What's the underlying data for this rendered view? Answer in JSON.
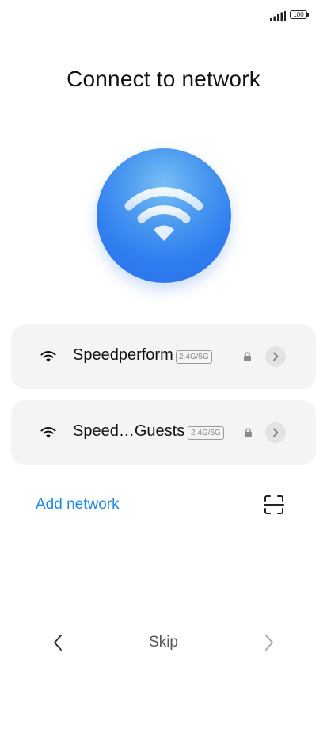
{
  "status_bar": {
    "battery_level": "100",
    "signal_icon": "cell-signal-icon",
    "battery_icon": "battery-icon"
  },
  "title": "Connect to network",
  "hero": {
    "icon": "wifi-icon",
    "gradient_colors": [
      "#79bff5",
      "#2f7df0"
    ]
  },
  "networks": [
    {
      "name": "Speedperform",
      "band": "2.4G/5G",
      "secured": true,
      "signal_icon": "wifi-icon",
      "detail_icon": "chevron-right-icon"
    },
    {
      "name": "Speed…Guests",
      "band": "2.4G/5G",
      "secured": true,
      "signal_icon": "wifi-icon",
      "detail_icon": "chevron-right-icon"
    }
  ],
  "add_network": {
    "label": "Add network",
    "scan_icon": "scan-qr-icon"
  },
  "nav": {
    "back_icon": "chevron-left-icon",
    "skip_label": "Skip",
    "next_icon": "chevron-right-icon"
  },
  "colors": {
    "accent": "#1a8ae6",
    "card_background": "#f4f4f4",
    "orb": "#2f7df0"
  }
}
